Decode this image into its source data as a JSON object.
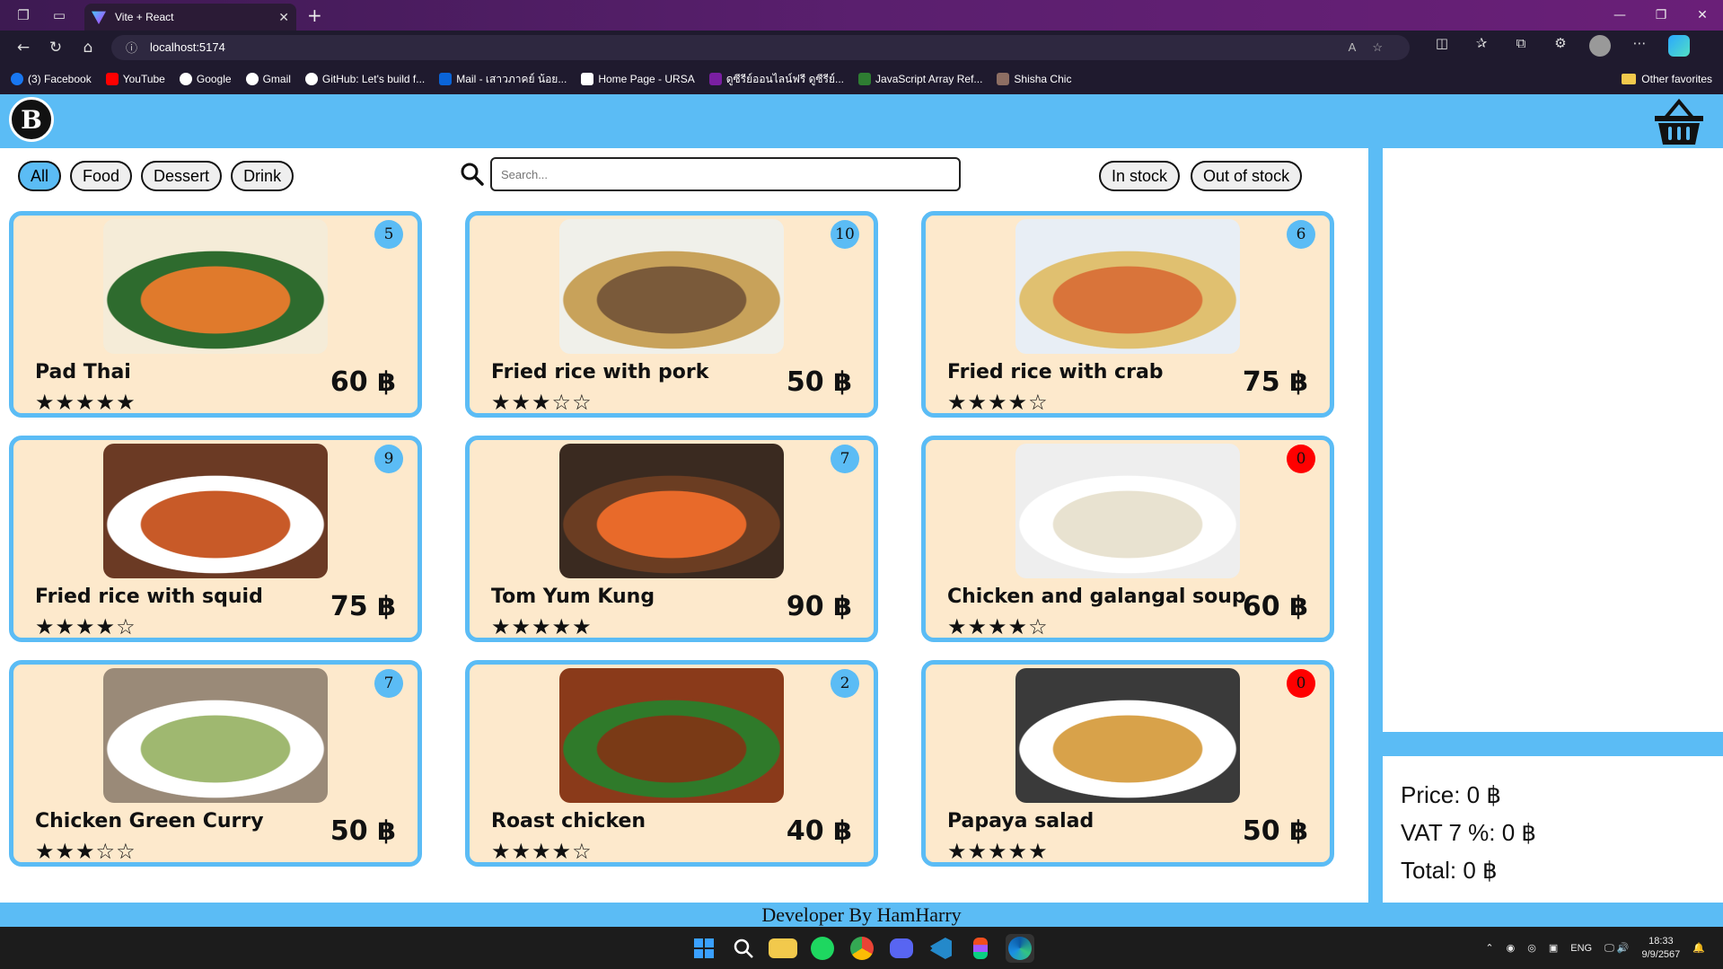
{
  "browser": {
    "tab_title": "Vite + React",
    "url": "localhost:5174",
    "bookmarks": [
      {
        "label": "(3) Facebook",
        "color": "#1877f2"
      },
      {
        "label": "YouTube",
        "color": "#ff0000"
      },
      {
        "label": "Google",
        "color": "#ffffff"
      },
      {
        "label": "Gmail",
        "color": "#ffffff"
      },
      {
        "label": "GitHub: Let's build f...",
        "color": "#ffffff"
      },
      {
        "label": "Mail - เสาวภาคย์ น้อย...",
        "color": "#0a64d8"
      },
      {
        "label": "Home Page - URSA",
        "color": "#ffffff"
      },
      {
        "label": "ดูซีรีย์ออนไลน์ฟรี ดูซีรีย์...",
        "color": "#7a1fa2"
      },
      {
        "label": "JavaScript Array Ref...",
        "color": "#2e7d32"
      },
      {
        "label": "Shisha Chic",
        "color": "#8d6e63"
      }
    ],
    "other_favorites": "Other favorites"
  },
  "filters": {
    "categories": [
      "All",
      "Food",
      "Dessert",
      "Drink"
    ],
    "active": "All",
    "search_placeholder": "Search...",
    "stock_options": [
      "In stock",
      "Out of stock"
    ]
  },
  "products": [
    {
      "name": "Pad Thai",
      "price": "60 ฿",
      "stock": "5",
      "rating": 5,
      "out": false,
      "img": [
        "#f5ecd8",
        "#2e6b2e",
        "#e07a2c"
      ]
    },
    {
      "name": "Fried rice with pork",
      "price": "50 ฿",
      "stock": "10",
      "rating": 3,
      "out": false,
      "img": [
        "#f0f0ea",
        "#c8a25a",
        "#7a5a3a"
      ]
    },
    {
      "name": "Fried rice with crab",
      "price": "75 ฿",
      "stock": "6",
      "rating": 4,
      "out": false,
      "img": [
        "#e8eef5",
        "#e0c070",
        "#d9743a"
      ]
    },
    {
      "name": "Fried rice with squid",
      "price": "75 ฿",
      "stock": "9",
      "rating": 4,
      "out": false,
      "img": [
        "#6b3a24",
        "#ffffff",
        "#c85a28"
      ]
    },
    {
      "name": "Tom Yum Kung",
      "price": "90 ฿",
      "stock": "7",
      "rating": 5,
      "out": false,
      "img": [
        "#3a2a20",
        "#6b3d22",
        "#e86a2a"
      ]
    },
    {
      "name": "Chicken and galangal soup",
      "price": "60 ฿",
      "stock": "0",
      "rating": 4,
      "out": true,
      "img": [
        "#eeeeee",
        "#ffffff",
        "#e8e2d0"
      ]
    },
    {
      "name": "Chicken Green Curry",
      "price": "50 ฿",
      "stock": "7",
      "rating": 3,
      "out": false,
      "img": [
        "#9a8a78",
        "#ffffff",
        "#9fb870"
      ]
    },
    {
      "name": "Roast chicken",
      "price": "40 ฿",
      "stock": "2",
      "rating": 4,
      "out": false,
      "img": [
        "#8a3a1a",
        "#2f7a2a",
        "#7a3a16"
      ]
    },
    {
      "name": "Papaya salad",
      "price": "50 ฿",
      "stock": "0",
      "rating": 5,
      "out": true,
      "img": [
        "#3a3a3a",
        "#ffffff",
        "#d8a24a"
      ]
    }
  ],
  "cart": {
    "price_line": "Price: 0 ฿",
    "vat_line": "VAT 7 %: 0 ฿",
    "total_line": "Total: 0 ฿"
  },
  "footer": "Developer By HamHarry",
  "taskbar": {
    "lang": "ENG",
    "time": "18:33",
    "date": "9/9/2567"
  }
}
